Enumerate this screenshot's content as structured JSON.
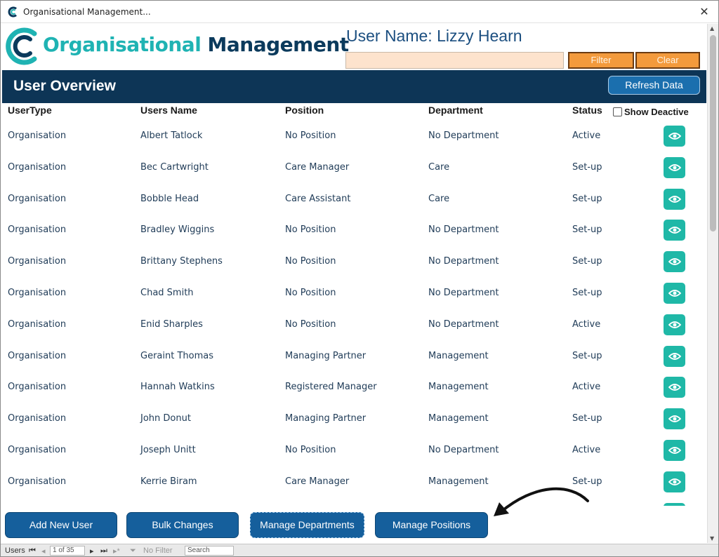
{
  "window": {
    "title": "Organisational Management..."
  },
  "header": {
    "logo_word1": "Organisational",
    "logo_word2": "Management",
    "username": "User Name: Lizzy Hearn",
    "filter_label": "Filter",
    "clear_label": "Clear"
  },
  "banner": {
    "title": "User Overview",
    "refresh_label": "Refresh Data"
  },
  "table": {
    "columns": {
      "usertype": "UserType",
      "name": "Users Name",
      "position": "Position",
      "department": "Department",
      "status": "Status"
    },
    "show_deactive_label": "Show Deactive",
    "rows": [
      {
        "usertype": "Organisation",
        "name": "Albert Tatlock",
        "position": "No Position",
        "department": "No Department",
        "status": "Active"
      },
      {
        "usertype": "Organisation",
        "name": "Bec Cartwright",
        "position": "Care Manager",
        "department": "Care",
        "status": "Set-up"
      },
      {
        "usertype": "Organisation",
        "name": "Bobble Head",
        "position": "Care Assistant",
        "department": "Care",
        "status": "Set-up"
      },
      {
        "usertype": "Organisation",
        "name": "Bradley Wiggins",
        "position": "No Position",
        "department": "No Department",
        "status": "Set-up"
      },
      {
        "usertype": "Organisation",
        "name": "Brittany Stephens",
        "position": "No Position",
        "department": "No Department",
        "status": "Set-up"
      },
      {
        "usertype": "Organisation",
        "name": "Chad Smith",
        "position": "No Position",
        "department": "No Department",
        "status": "Set-up"
      },
      {
        "usertype": "Organisation",
        "name": "Enid Sharples",
        "position": "No Position",
        "department": "No Department",
        "status": "Active"
      },
      {
        "usertype": "Organisation",
        "name": "Geraint Thomas",
        "position": "Managing Partner",
        "department": "Management",
        "status": "Set-up"
      },
      {
        "usertype": "Organisation",
        "name": "Hannah Watkins",
        "position": "Registered Manager",
        "department": "Management",
        "status": "Active"
      },
      {
        "usertype": "Organisation",
        "name": "John Donut",
        "position": "Managing Partner",
        "department": "Management",
        "status": "Set-up"
      },
      {
        "usertype": "Organisation",
        "name": "Joseph Unitt",
        "position": "No Position",
        "department": "No Department",
        "status": "Active"
      },
      {
        "usertype": "Organisation",
        "name": "Kerrie Biram",
        "position": "Care Manager",
        "department": "Management",
        "status": "Set-up"
      }
    ]
  },
  "footer": {
    "add_user": "Add New User",
    "bulk_changes": "Bulk Changes",
    "manage_departments": "Manage Departments",
    "manage_positions": "Manage Positions"
  },
  "navbar": {
    "label": "Users",
    "record": "1 of 35",
    "filter_state": "No Filter",
    "search_placeholder": "Search"
  },
  "colors": {
    "teal": "#1fb3b3",
    "navy": "#0d3556",
    "orange": "#f39a3c",
    "button_blue": "#155f9c",
    "eye_teal": "#1fb8a7"
  },
  "icons": [
    "app-logo-icon",
    "close-icon",
    "eye-icon",
    "arrow-annotation-icon",
    "first-record-icon",
    "prev-record-icon",
    "next-record-icon",
    "last-record-icon",
    "new-record-icon",
    "filter-icon"
  ]
}
